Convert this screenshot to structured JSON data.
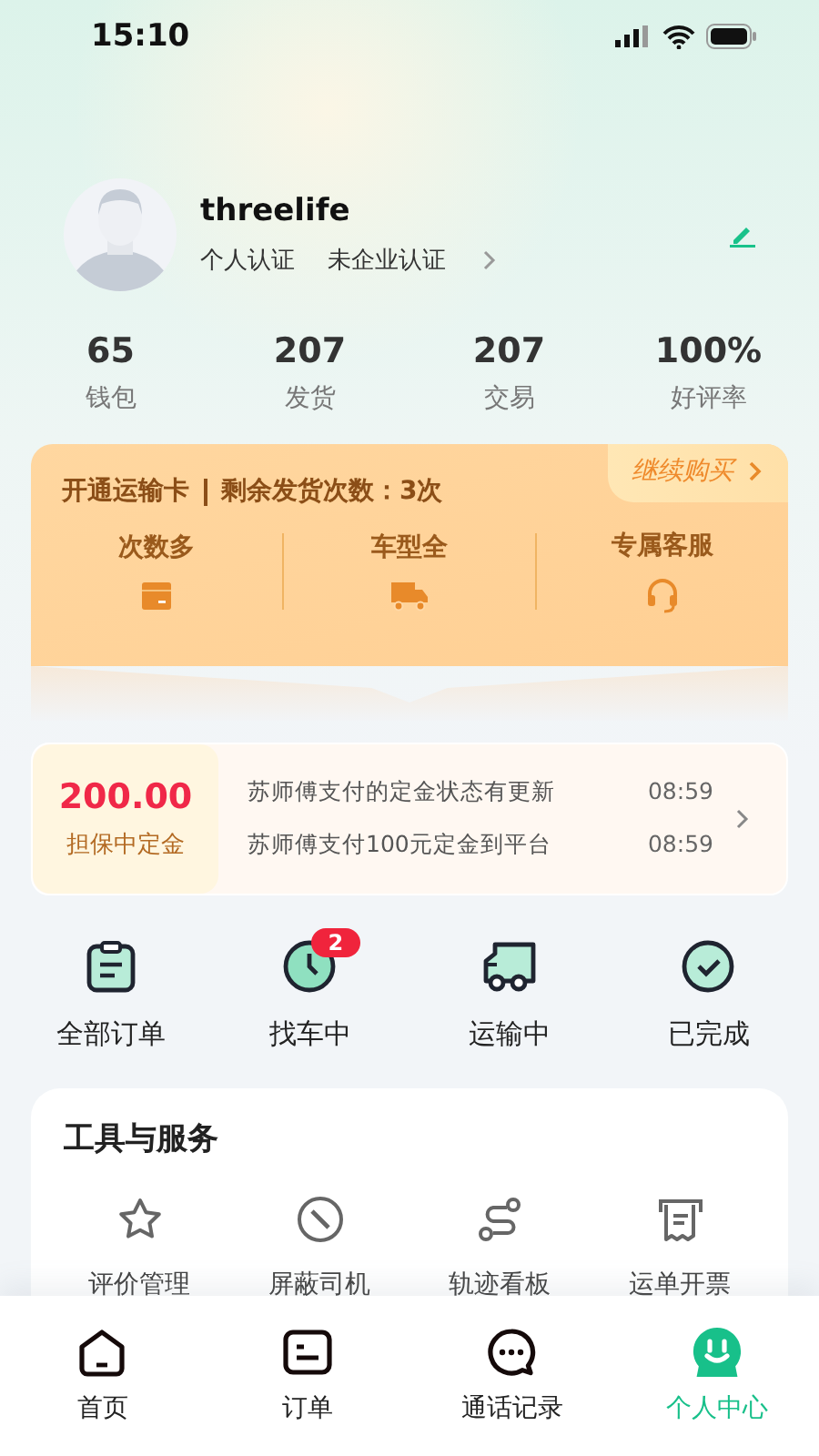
{
  "status_bar": {
    "time": "15:10"
  },
  "profile": {
    "name": "threelife",
    "personal_cert": "个人认证",
    "enterprise_cert": "未企业认证"
  },
  "stats": [
    {
      "value": "65",
      "label": "钱包"
    },
    {
      "value": "207",
      "label": "发货"
    },
    {
      "value": "207",
      "label": "交易"
    },
    {
      "value": "100%",
      "label": "好评率"
    }
  ],
  "transport_card": {
    "title": "开通运输卡",
    "remaining": "剩余发货次数：3次",
    "buy_button": "继续购买",
    "features": [
      {
        "label": "次数多",
        "kind": "box"
      },
      {
        "label": "车型全",
        "kind": "truck"
      },
      {
        "label": "专属客服",
        "kind": "headset"
      }
    ]
  },
  "deposit": {
    "amount": "200.00",
    "label": "担保中定金",
    "messages": [
      {
        "text": "苏师傅支付的定金状态有更新",
        "time": "08:59"
      },
      {
        "text": "苏师傅支付100元定金到平台",
        "time": "08:59"
      }
    ]
  },
  "order_status": [
    {
      "label": "全部订单",
      "kind": "clipboard"
    },
    {
      "label": "找车中",
      "kind": "clock",
      "badge": "2"
    },
    {
      "label": "运输中",
      "kind": "truck"
    },
    {
      "label": "已完成",
      "kind": "check"
    }
  ],
  "tools": {
    "title": "工具与服务",
    "items": [
      {
        "label": "评价管理",
        "kind": "star"
      },
      {
        "label": "屏蔽司机",
        "kind": "block"
      },
      {
        "label": "轨迹看板",
        "kind": "route"
      },
      {
        "label": "运单开票",
        "kind": "receipt"
      }
    ]
  },
  "tab_bar": [
    {
      "label": "首页",
      "kind": "home",
      "selected": false
    },
    {
      "label": "订单",
      "kind": "order",
      "selected": false
    },
    {
      "label": "通话记录",
      "kind": "chat",
      "selected": false
    },
    {
      "label": "个人中心",
      "kind": "user",
      "selected": true
    }
  ]
}
